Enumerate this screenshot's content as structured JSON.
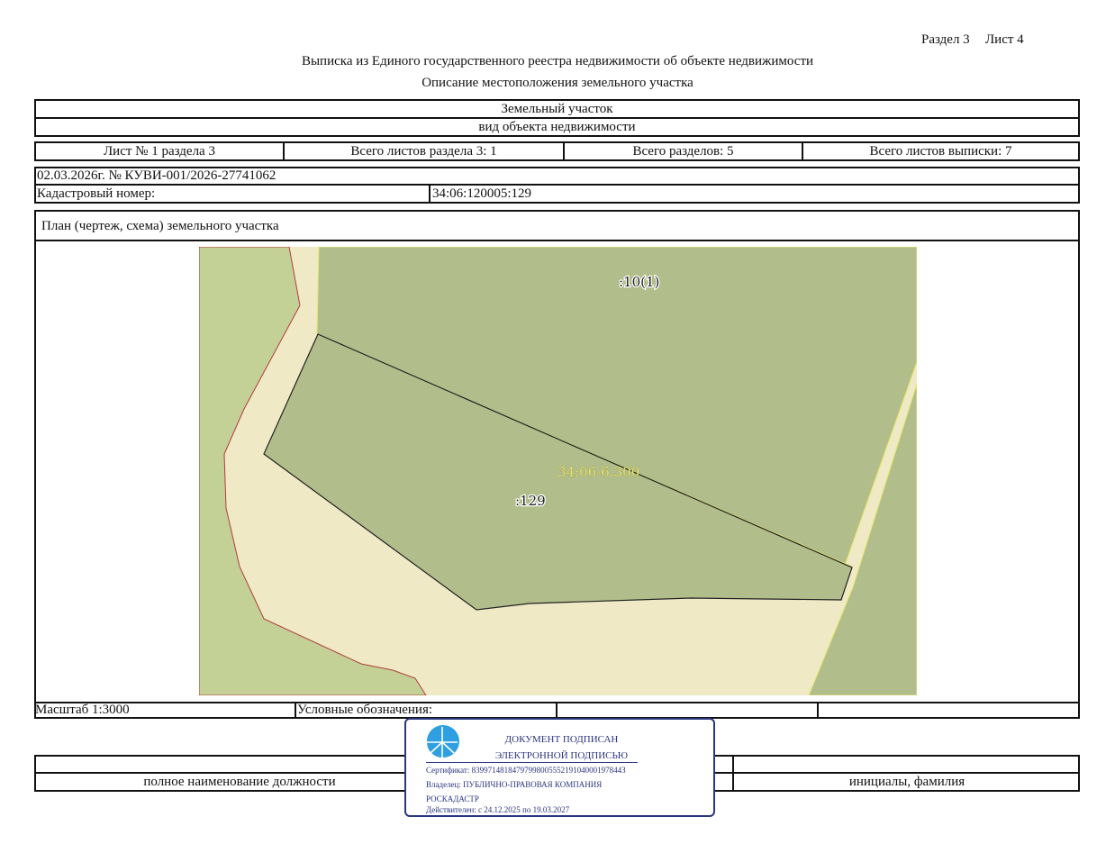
{
  "header": {
    "section": "Раздел 3",
    "sheet": "Лист 4",
    "title": "Выписка из Единого государственного реестра недвижимости об объекте недвижимости",
    "subtitle": "Описание местоположения земельного участка"
  },
  "object": {
    "name": "Земельный участок",
    "type_caption": "вид объекта недвижимости"
  },
  "sheets_row": {
    "sheet_of_section": "Лист № 1 раздела 3",
    "total_section_sheets": "Всего листов раздела 3: 1",
    "total_sections": "Всего разделов: 5",
    "total_extract_sheets": "Всего листов выписки: 7"
  },
  "record": {
    "date_number": "02.03.2026г. № КУВИ-001/2026-27741062",
    "cadastral_label": "Кадастровый номер:",
    "cadastral_number": "34:06:120005:129"
  },
  "plan": {
    "title": "План (чертеж, схема) земельного участка",
    "labels": {
      "neighbor": ":10(1)",
      "quarter": "34:06-6.300",
      "parcel": ":129"
    },
    "colors": {
      "parcel_fill": "#b1bd8b",
      "road_fill": "#efe9c5",
      "left_land": "#c3d096",
      "boundary_red": "#b0403a",
      "quarter_label": "#e7e47a"
    }
  },
  "footer": {
    "scale": "Масштаб 1:3000",
    "legend_label": "Условные обозначения:",
    "position_caption": "полное наименование должности",
    "name_caption": "инициалы, фамилия"
  },
  "stamp": {
    "line1": "ДОКУМЕНТ ПОДПИСАН",
    "line2": "ЭЛЕКТРОННОЙ ПОДПИСЬЮ",
    "certificate": "Сертификат: 8399714818479799800555219104000197844З",
    "owner": "Владелец: ПУБЛИЧНО-ПРАВОВАЯ КОМПАНИЯ",
    "owner2": "РОСКАДАСТР",
    "valid": "Действителен: с 24.12.2025 по 19.03.2027",
    "logo_color": "#2e9fe0",
    "border_color": "#2b3580"
  }
}
